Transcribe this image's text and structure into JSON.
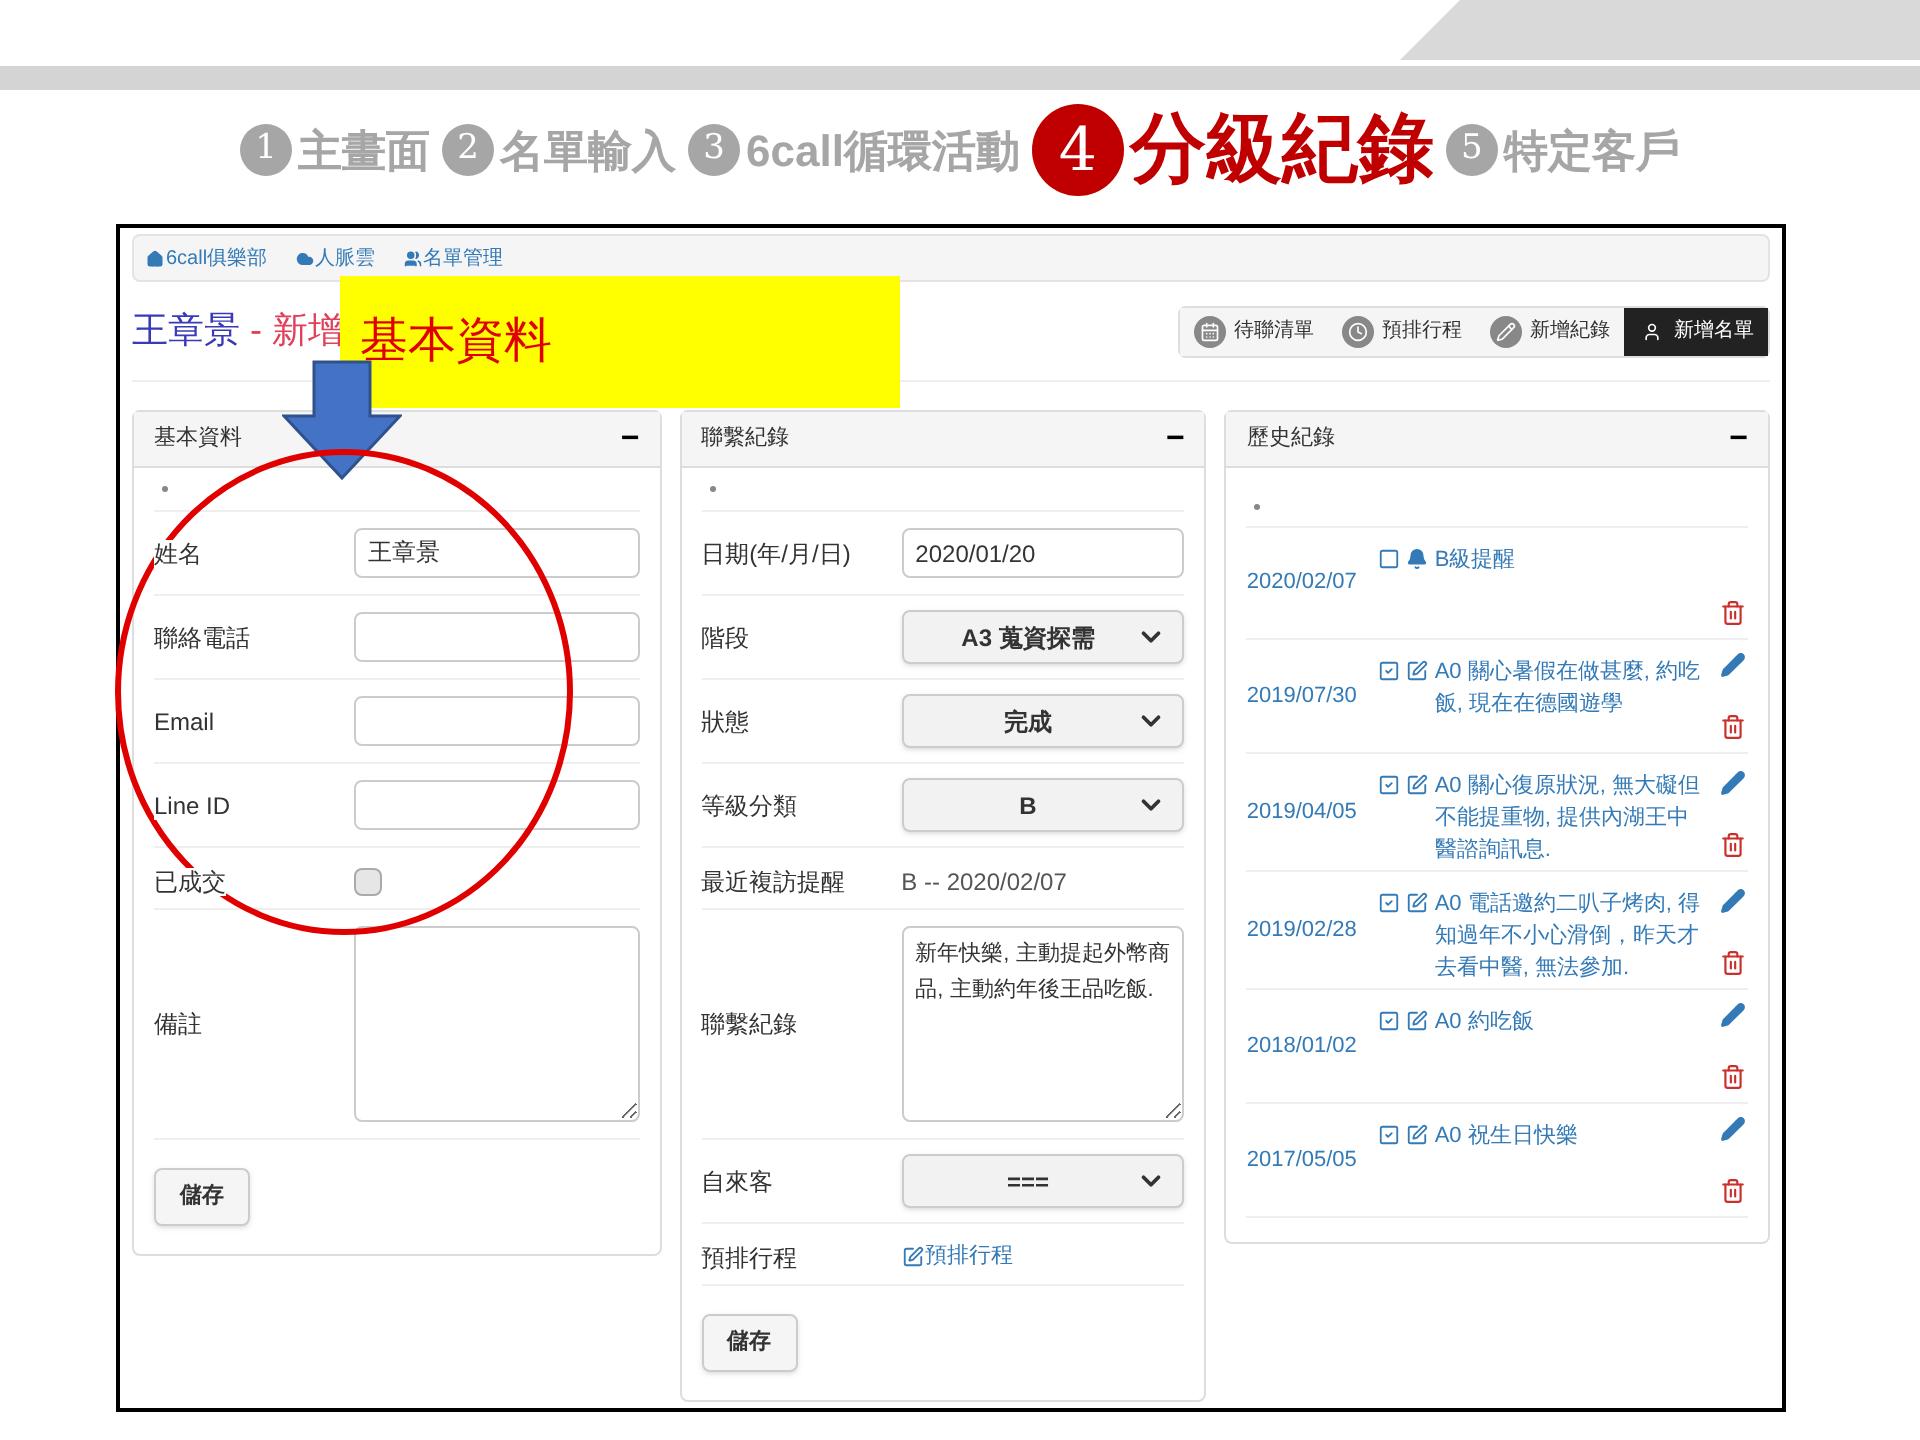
{
  "steps": [
    {
      "number": "1",
      "label": "主畫面",
      "selected": false
    },
    {
      "number": "2",
      "label": "名單輸入",
      "selected": false
    },
    {
      "number": "3",
      "label": "6call循環活動",
      "selected": false
    },
    {
      "number": "4",
      "label": "分級紀錄",
      "selected": true
    },
    {
      "number": "5",
      "label": "特定客戶",
      "selected": false
    }
  ],
  "app": {
    "breadcrumb": [
      {
        "label": "6call俱樂部",
        "kind": "home"
      },
      {
        "label": "人脈雲",
        "kind": "cloud"
      },
      {
        "label": "名單管理",
        "kind": "users"
      }
    ],
    "title": {
      "name": "王章景",
      "suffix": " - 新增"
    },
    "toolbar": [
      {
        "label": "待聯清單",
        "kind": "list",
        "selected": false
      },
      {
        "label": "預排行程",
        "kind": "clock",
        "selected": false
      },
      {
        "label": "新增紀錄",
        "kind": "pencil",
        "selected": false
      },
      {
        "label": "新增名單",
        "kind": "user",
        "selected": true
      }
    ],
    "basic_panel": {
      "title": "基本資料",
      "collapse": "−",
      "fields": [
        {
          "kind": "text",
          "label": "姓名",
          "value": "王章景"
        },
        {
          "kind": "text",
          "label": "聯絡電話"
        },
        {
          "kind": "text",
          "label": "Email"
        },
        {
          "kind": "text",
          "label": "Line ID"
        },
        {
          "kind": "checkbox",
          "label": "已成交",
          "checked": false
        },
        {
          "kind": "textarea",
          "label": "備註"
        }
      ],
      "save_button": "儲存"
    },
    "contact_panel": {
      "title": "聯繫紀錄",
      "collapse": "−",
      "fields": [
        {
          "kind": "text",
          "label": "日期(年/月/日)",
          "value": "2020/01/20"
        },
        {
          "kind": "select",
          "label": "階段",
          "value": "A3 蒐資探需"
        },
        {
          "kind": "select",
          "label": "狀態",
          "value": "完成"
        },
        {
          "kind": "select",
          "label": "等級分類",
          "value": "B"
        },
        {
          "kind": "static",
          "label": "最近複訪提醒",
          "value": "B -- 2020/02/07"
        },
        {
          "kind": "textarea",
          "label": "聯繫紀錄",
          "value": "新年快樂, 主動提起外幣商品, 主動約年後王品吃飯."
        },
        {
          "kind": "select",
          "label": "自來客",
          "value": "==="
        },
        {
          "kind": "link",
          "label": "預排行程",
          "value": "預排行程"
        }
      ],
      "save_button": "儲存"
    },
    "history_panel": {
      "title": "歷史紀錄",
      "collapse": "−",
      "entries": [
        {
          "date": "2020/02/07",
          "kind": "reminder",
          "done": false,
          "text": "B級提醒"
        },
        {
          "date": "2019/07/30",
          "kind": "record",
          "done": true,
          "text": "A0 關心暑假在做甚麼, 約吃飯, 現在在德國遊學"
        },
        {
          "date": "2019/04/05",
          "kind": "record",
          "done": true,
          "text": "A0 關心復原狀況, 無大礙但不能提重物, 提供內湖王中醫諮詢訊息."
        },
        {
          "date": "2019/02/28",
          "kind": "record",
          "done": true,
          "text": "A0 電話邀約二叭子烤肉, 得知過年不小心滑倒，昨天才去看中醫, 無法參加."
        },
        {
          "date": "2018/01/02",
          "kind": "record",
          "done": true,
          "text": "A0 約吃飯"
        },
        {
          "date": "2017/05/05",
          "kind": "record",
          "done": true,
          "text": "A0 祝生日快樂"
        }
      ]
    }
  },
  "callout": {
    "text": "基本資料"
  }
}
